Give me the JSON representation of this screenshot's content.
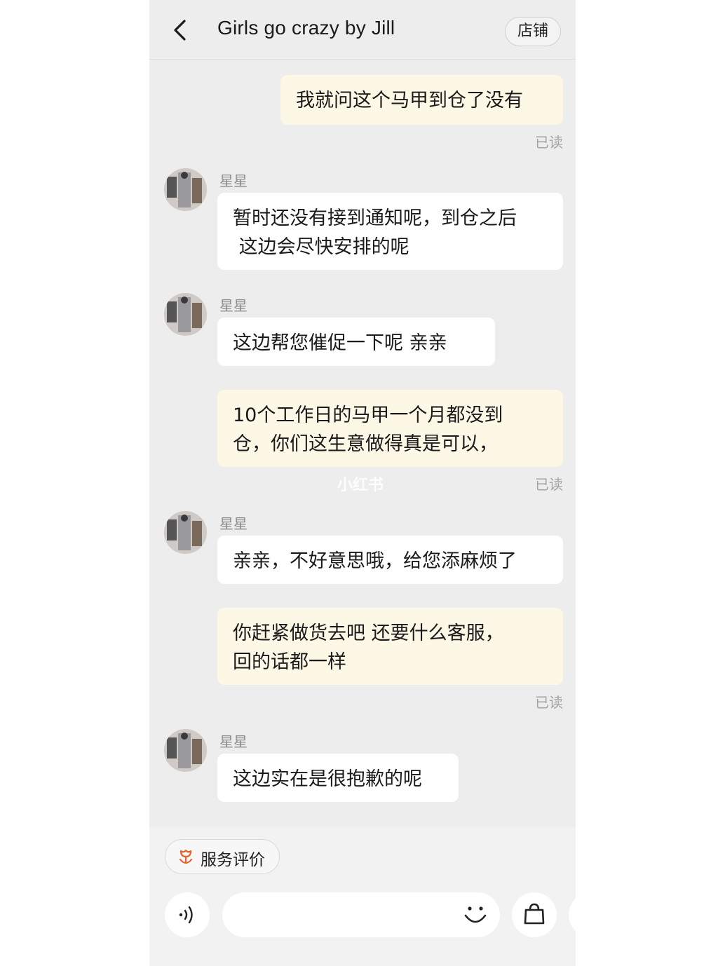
{
  "header": {
    "title": "Girls go crazy by Jill",
    "shop_label": "店铺"
  },
  "messages": [
    {
      "text": "我就问这个马甲到仓了没有",
      "read": "已读"
    },
    {
      "sender": "星星",
      "text": "暂时还没有接到通知呢，到仓之后\n 这边会尽快安排的呢"
    },
    {
      "sender": "星星",
      "text": "这边帮您催促一下呢 亲亲"
    },
    {
      "text": "10个工作日的马甲一个月都没到\n仓，你们这生意做得真是可以，",
      "read": "已读"
    },
    {
      "sender": "星星",
      "text": "亲亲，不好意思哦，给您添麻烦了"
    },
    {
      "text": "你赶紧做货去吧 还要什么客服，\n回的话都一样",
      "read": "已读"
    },
    {
      "sender": "星星",
      "text": "这边实在是很抱歉的呢"
    }
  ],
  "watermark": "小红书",
  "footer": {
    "rate_label": "服务评价",
    "input_value": ""
  },
  "colors": {
    "outgoing_bubble": "#fdf7e6",
    "incoming_bubble": "#ffffff",
    "background": "#ededed",
    "rate_icon": "#e8612c"
  },
  "icons": [
    "back-arrow-icon",
    "flower-icon",
    "voice-icon",
    "smile-icon",
    "shopping-bag-icon"
  ]
}
